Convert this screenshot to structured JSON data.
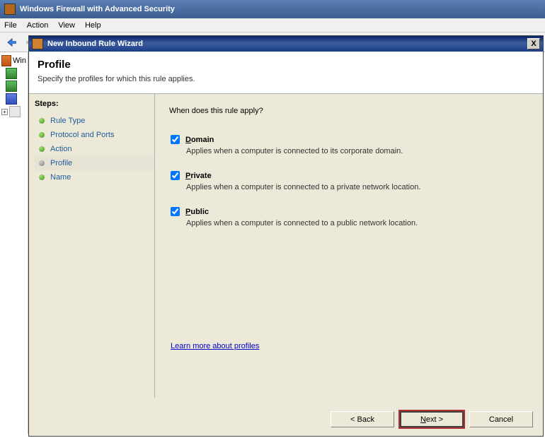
{
  "window": {
    "title": "Windows Firewall with Advanced Security"
  },
  "menubar": {
    "file": "File",
    "action": "Action",
    "view": "View",
    "help": "Help"
  },
  "tree": {
    "root": "Win"
  },
  "dialog": {
    "title": "New Inbound Rule Wizard",
    "close": "X",
    "header_title": "Profile",
    "header_subtitle": "Specify the profiles for which this rule applies."
  },
  "steps": {
    "heading": "Steps:",
    "items": [
      "Rule Type",
      "Protocol and Ports",
      "Action",
      "Profile",
      "Name"
    ],
    "active_index": 3
  },
  "content": {
    "prompt": "When does this rule apply?",
    "profiles": [
      {
        "label": "Domain",
        "accel": "D",
        "rest": "omain",
        "desc": "Applies when a computer is connected to its corporate domain.",
        "checked": true
      },
      {
        "label": "Private",
        "accel": "P",
        "rest": "rivate",
        "desc": "Applies when a computer is connected to a private network location.",
        "checked": true
      },
      {
        "label": "Public",
        "accel": "P",
        "rest": "ublic",
        "desc": "Applies when a computer is connected to a public network location.",
        "checked": true
      }
    ],
    "learn_link": "Learn more about profiles"
  },
  "buttons": {
    "back": "< Back",
    "next": "Next >",
    "cancel": "Cancel"
  }
}
